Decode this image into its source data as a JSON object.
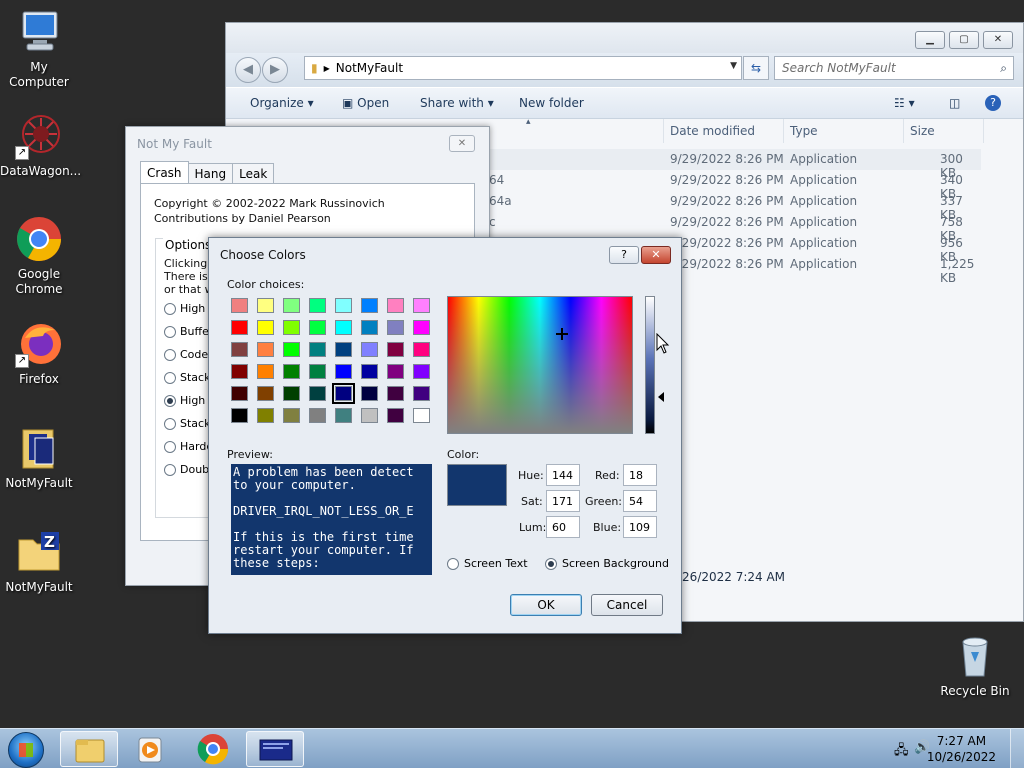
{
  "desktop": {
    "icons": [
      {
        "label": "My Computer"
      },
      {
        "label": "DataWagon..."
      },
      {
        "label": "Google Chrome"
      },
      {
        "label": "Firefox"
      },
      {
        "label": "NotMyFault"
      },
      {
        "label": "NotMyFault"
      },
      {
        "label": "Recycle Bin"
      }
    ]
  },
  "explorer": {
    "address": "NotMyFault",
    "search_placeholder": "Search NotMyFault",
    "toolbar": {
      "organize": "Organize",
      "open": "Open",
      "share_with": "Share with",
      "new_folder": "New folder"
    },
    "columns": {
      "date": "Date modified",
      "type": "Type",
      "size": "Size"
    },
    "rows": [
      {
        "name": "",
        "date": "9/29/2022 8:26 PM",
        "type": "Application",
        "size": "300 KB"
      },
      {
        "name": "64",
        "date": "9/29/2022 8:26 PM",
        "type": "Application",
        "size": "340 KB"
      },
      {
        "name": "64a",
        "date": "9/29/2022 8:26 PM",
        "type": "Application",
        "size": "337 KB"
      },
      {
        "name": "c",
        "date": "9/29/2022 8:26 PM",
        "type": "Application",
        "size": "758 KB"
      },
      {
        "name": "",
        "date": "9/29/2022 8:26 PM",
        "type": "Application",
        "size": "956 KB"
      },
      {
        "name": "",
        "date": "9/29/2022 8:26 PM",
        "type": "Application",
        "size": "1,225 KB"
      }
    ],
    "status_date": "/26/2022 7:24 AM"
  },
  "notmyfault": {
    "title": "Not My Fault",
    "tabs": [
      "Crash",
      "Hang",
      "Leak"
    ],
    "copyright": "Copyright © 2002-2022 Mark Russinovich",
    "contributions": "Contributions by Daniel Pearson",
    "options_title": "Options",
    "description_lines": [
      "Clicking th",
      "There is a",
      "or that w"
    ],
    "options": [
      {
        "label": "High I",
        "checked": false
      },
      {
        "label": "Buffer",
        "checked": false
      },
      {
        "label": "Code c",
        "checked": false
      },
      {
        "label": "Stack",
        "checked": false
      },
      {
        "label": "High I",
        "checked": true
      },
      {
        "label": "Stack",
        "checked": false
      },
      {
        "label": "Hardco",
        "checked": false
      },
      {
        "label": "Double",
        "checked": false
      }
    ]
  },
  "choose_colors": {
    "title": "Choose Colors",
    "help_label": "?",
    "close_label": "✕",
    "color_choices_label": "Color choices:",
    "swatches": [
      "#f08080",
      "#ffff80",
      "#80ff80",
      "#00ff80",
      "#80ffff",
      "#0080ff",
      "#ff80c0",
      "#ff80ff",
      "#ff0000",
      "#ffff00",
      "#80ff00",
      "#00ff40",
      "#00ffff",
      "#0080c0",
      "#8080c0",
      "#ff00ff",
      "#804040",
      "#ff8040",
      "#00ff00",
      "#008080",
      "#004080",
      "#8080ff",
      "#800040",
      "#ff0080",
      "#800000",
      "#ff8000",
      "#008000",
      "#008040",
      "#0000ff",
      "#0000a0",
      "#800080",
      "#8000ff",
      "#400000",
      "#804000",
      "#004000",
      "#004040",
      "#000080",
      "#000040",
      "#400040",
      "#400080",
      "#000000",
      "#808000",
      "#808040",
      "#808080",
      "#408080",
      "#c0c0c0",
      "#400040",
      "#ffffff"
    ],
    "selected_swatch_index": 36,
    "preview_label": "Preview:",
    "preview_text": "A problem has been detect\nto your computer.\n\nDRIVER_IRQL_NOT_LESS_OR_E\n\nIf this is the first time\nrestart your computer. If\nthese steps:",
    "color_label": "Color:",
    "current_color": "#12366d",
    "fields": {
      "hue_label": "Hue:",
      "hue": "144",
      "sat_label": "Sat:",
      "sat": "171",
      "lum_label": "Lum:",
      "lum": "60",
      "red_label": "Red:",
      "red": "18",
      "green_label": "Green:",
      "green": "54",
      "blue_label": "Blue:",
      "blue": "109"
    },
    "screen_text_label": "Screen Text",
    "screen_background_label": "Screen Background",
    "screen_background_selected": true,
    "ok_label": "OK",
    "cancel_label": "Cancel"
  },
  "taskbar": {
    "time": "7:27 AM",
    "date": "10/26/2022"
  }
}
